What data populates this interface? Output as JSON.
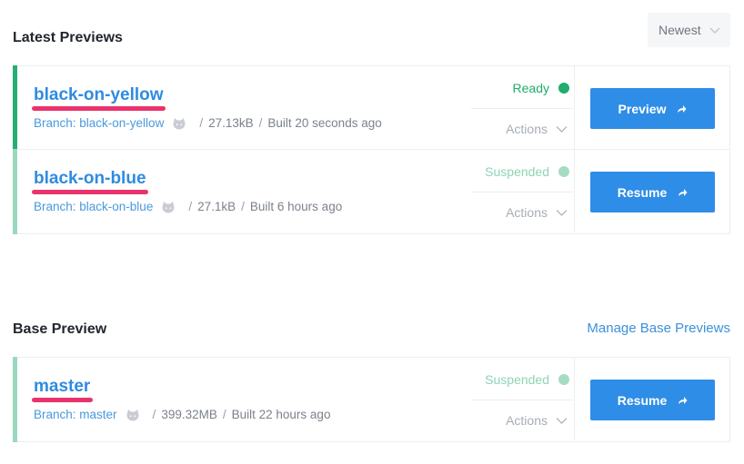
{
  "latest": {
    "title": "Latest Previews",
    "sort": {
      "selected": "Newest"
    },
    "previews": [
      {
        "name": "black-on-yellow",
        "branch": "Branch: black-on-yellow",
        "size": "27.13kB",
        "built": "Built 20 seconds ago",
        "status": "Ready",
        "status_color": "#1fae6b",
        "dot_color": "#1fae6b",
        "bar_color": "#27ae72",
        "actions": "Actions",
        "button": "Preview"
      },
      {
        "name": "black-on-blue",
        "branch": "Branch: black-on-blue",
        "size": "27.1kB",
        "built": "Built 6 hours ago",
        "status": "Suspended",
        "status_color": "#8fd3b5",
        "dot_color": "#a5dcc4",
        "bar_color": "#9bd8bf",
        "actions": "Actions",
        "button": "Resume"
      }
    ]
  },
  "base": {
    "title": "Base Preview",
    "manage_link": "Manage Base Previews",
    "preview": {
      "name": "master",
      "branch": "Branch: master",
      "size": "399.32MB",
      "built": "Built 22 hours ago",
      "status": "Suspended",
      "status_color": "#8fd3b5",
      "dot_color": "#a5dcc4",
      "bar_color": "#9bd8bf",
      "actions": "Actions",
      "button": "Resume"
    }
  },
  "colors": {
    "accent": "#2e8de6",
    "link": "#3c91d9",
    "highlight_underline": "#e8336d"
  }
}
